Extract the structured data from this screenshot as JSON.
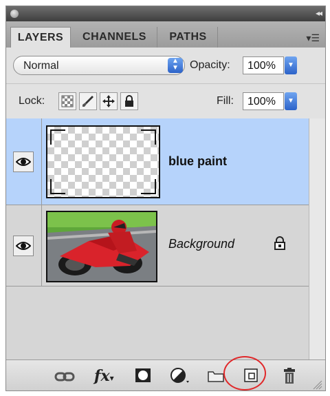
{
  "tabs": [
    {
      "label": "LAYERS",
      "active": true
    },
    {
      "label": "CHANNELS",
      "active": false
    },
    {
      "label": "PATHS",
      "active": false
    }
  ],
  "blend_mode": {
    "value": "Normal"
  },
  "opacity": {
    "label": "Opacity:",
    "value": "100%"
  },
  "lock": {
    "label": "Lock:",
    "buttons": [
      "transparency-lock-icon",
      "brush-lock-icon",
      "move-lock-icon",
      "padlock-icon"
    ]
  },
  "fill": {
    "label": "Fill:",
    "value": "100%"
  },
  "layers": [
    {
      "name": "blue paint",
      "visible": true,
      "selected": true,
      "thumbnail": "transparent-checkerboard",
      "locked": false
    },
    {
      "name": "Background",
      "visible": true,
      "selected": false,
      "thumbnail": "motorcycle-photo",
      "locked": true
    }
  ],
  "bottom_toolbar": [
    "link-layers-icon",
    "fx-icon",
    "layer-mask-icon",
    "adjustment-layer-icon",
    "group-folder-icon",
    "new-layer-icon",
    "trash-icon"
  ],
  "highlight": {
    "target": "new-layer-icon",
    "color": "#e0282a"
  },
  "colors": {
    "selected_row": "#b6d3fb",
    "accent_blue": "#2c63c9"
  }
}
